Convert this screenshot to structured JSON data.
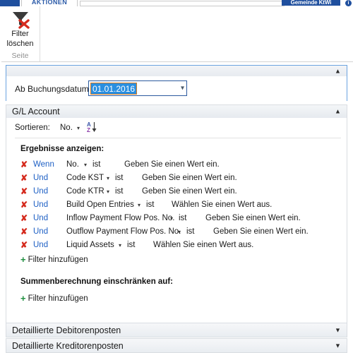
{
  "window": {
    "ribbon_tab": "AKTIONEN",
    "company_button": "Gemeinde KtWi",
    "info_icon": "info-icon"
  },
  "ribbon": {
    "clear_filter_label_line1": "Filter",
    "clear_filter_label_line2": "löschen",
    "group_label": "Seite",
    "icon": "filter-clear-icon"
  },
  "date_panel": {
    "collapse_icon": "chevron-up-icon",
    "label": "Ab Buchungsdatum:",
    "value": "01.01.2016",
    "dropdown_icon": "chevron-down-icon"
  },
  "gl_section": {
    "title": "G/L Account",
    "collapse_icon": "chevron-up-icon",
    "sort_label": "Sortieren:",
    "sort_value": "No.",
    "sort_caret_icon": "caret-down-icon",
    "sort_direction_icon": "sort-az-ascending-icon",
    "results_title": "Ergebnisse anzeigen:",
    "filters": [
      {
        "remove_icon": "remove-x-icon",
        "conjunction": "Wenn",
        "field": "No.",
        "caret": "caret-down-icon",
        "operator": "ist",
        "value": "Geben Sie einen Wert ein."
      },
      {
        "remove_icon": "remove-x-icon",
        "conjunction": "Und",
        "field": "Code KST",
        "caret": "caret-down-icon",
        "operator": "ist",
        "value": "Geben Sie einen Wert ein."
      },
      {
        "remove_icon": "remove-x-icon",
        "conjunction": "Und",
        "field": "Code KTR",
        "caret": "caret-down-icon",
        "operator": "ist",
        "value": "Geben Sie einen Wert ein."
      },
      {
        "remove_icon": "remove-x-icon",
        "conjunction": "Und",
        "field": "Build Open Entries",
        "caret": "caret-down-icon",
        "operator": "ist",
        "value": "Wählen Sie einen Wert aus."
      },
      {
        "remove_icon": "remove-x-icon",
        "conjunction": "Und",
        "field": "Inflow Payment Flow Pos. No.",
        "caret": "caret-down-icon",
        "operator": "ist",
        "value": "Geben Sie einen Wert ein."
      },
      {
        "remove_icon": "remove-x-icon",
        "conjunction": "Und",
        "field": "Outflow Payment Flow Pos. No.",
        "caret": "caret-down-icon",
        "operator": "ist",
        "value": "Geben Sie einen Wert ein."
      },
      {
        "remove_icon": "remove-x-icon",
        "conjunction": "Und",
        "field": "Liquid Assets",
        "caret": "caret-down-icon",
        "operator": "ist",
        "value": "Wählen Sie einen Wert aus."
      }
    ],
    "add_filter_1": "Filter hinzufügen",
    "totals_title": "Summenberechnung einschränken auf:",
    "add_filter_2": "Filter hinzufügen"
  },
  "collapsed_sections": [
    {
      "title": "Detaillierte Debitorenposten",
      "expand_icon": "chevron-down-icon"
    },
    {
      "title": "Detaillierte Kreditorenposten",
      "expand_icon": "chevron-down-icon"
    }
  ],
  "colors": {
    "accent_blue": "#1f4f9e",
    "link_blue": "#1d5fc4",
    "remove_red": "#d52b1e",
    "add_green": "#1f8f3f",
    "selection_blue": "#2a8fe0",
    "focus_border": "#6ba3e0"
  }
}
